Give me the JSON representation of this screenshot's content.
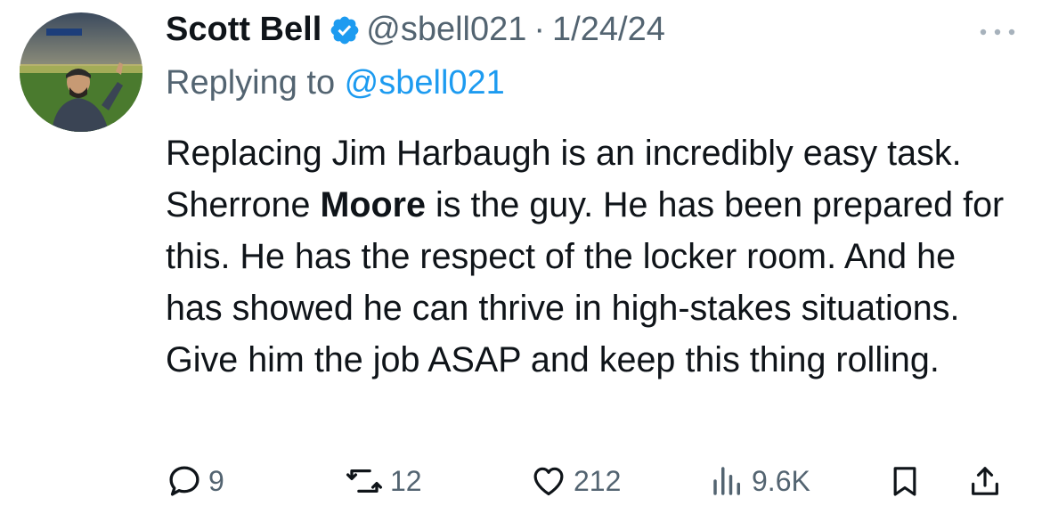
{
  "tweet": {
    "author_name": "Scott Bell",
    "handle": "@sbell021",
    "separator": "·",
    "date": "1/24/24",
    "replying_prefix": "Replying to ",
    "replying_handle": "@sbell021",
    "text_part1": "Replacing Jim Harbaugh is an incredibly easy task. Sherrone ",
    "text_bold": "Moore",
    "text_part2": " is the guy. He has been prepared for this. He has the respect of the locker room. And he has showed he can thrive in high-stakes situations. Give him the job ASAP and keep this thing rolling."
  },
  "actions": {
    "replies": "9",
    "retweets": "12",
    "likes": "212",
    "views": "9.6K"
  },
  "icons": {
    "verified": "verified-badge-icon",
    "more": "more-dots-icon",
    "reply": "reply-bubble-icon",
    "retweet": "retweet-icon",
    "like": "heart-icon",
    "views": "views-bars-icon",
    "bookmark": "bookmark-icon",
    "share": "share-icon"
  },
  "colors": {
    "text": "#0f1419",
    "secondary": "#536471",
    "link": "#1d9bf0",
    "verified": "#1d9bf0"
  }
}
